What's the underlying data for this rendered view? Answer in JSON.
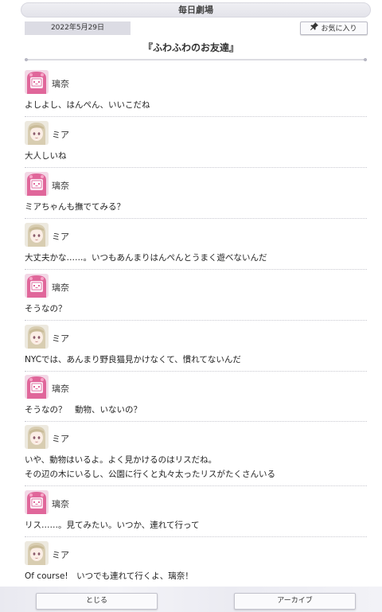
{
  "header": {
    "title": "毎日劇場"
  },
  "date": "2022年5月29日",
  "favorite_button": {
    "label": "お気に入り",
    "icon": "pin-icon"
  },
  "episode_title": "『ふわふわのお友達』",
  "characters": {
    "rina": {
      "name": "璃奈",
      "avatar": "rina-avatar",
      "color": "#e0669a"
    },
    "mia": {
      "name": "ミア",
      "avatar": "mia-avatar",
      "color": "#cfc3a7"
    }
  },
  "dialogue": [
    {
      "speaker": "rina",
      "name": "璃奈",
      "lines": [
        "よしよし、はんぺん、いいこだね"
      ]
    },
    {
      "speaker": "mia",
      "name": "ミア",
      "lines": [
        "大人しいね"
      ]
    },
    {
      "speaker": "rina",
      "name": "璃奈",
      "lines": [
        "ミアちゃんも撫でてみる？"
      ]
    },
    {
      "speaker": "mia",
      "name": "ミア",
      "lines": [
        "大丈夫かな……。いつもあんまりはんぺんとうまく遊べないんだ"
      ]
    },
    {
      "speaker": "rina",
      "name": "璃奈",
      "lines": [
        "そうなの？"
      ]
    },
    {
      "speaker": "mia",
      "name": "ミア",
      "lines": [
        "NYCでは、あんまり野良猫見かけなくて、慣れてないんだ"
      ]
    },
    {
      "speaker": "rina",
      "name": "璃奈",
      "lines": [
        "そうなの？　動物、いないの？"
      ]
    },
    {
      "speaker": "mia",
      "name": "ミア",
      "lines": [
        "いや、動物はいるよ。よく見かけるのはリスだね。",
        "その辺の木にいるし、公園に行くと丸々太ったリスがたくさんいる"
      ]
    },
    {
      "speaker": "rina",
      "name": "璃奈",
      "lines": [
        "リス……。見てみたい。いつか、連れて行って"
      ]
    },
    {
      "speaker": "mia",
      "name": "ミア",
      "lines": [
        "Of course!　いつでも連れて行くよ、璃奈！"
      ]
    }
  ],
  "footer": {
    "close_label": "とじる",
    "archive_label": "アーカイブ"
  }
}
